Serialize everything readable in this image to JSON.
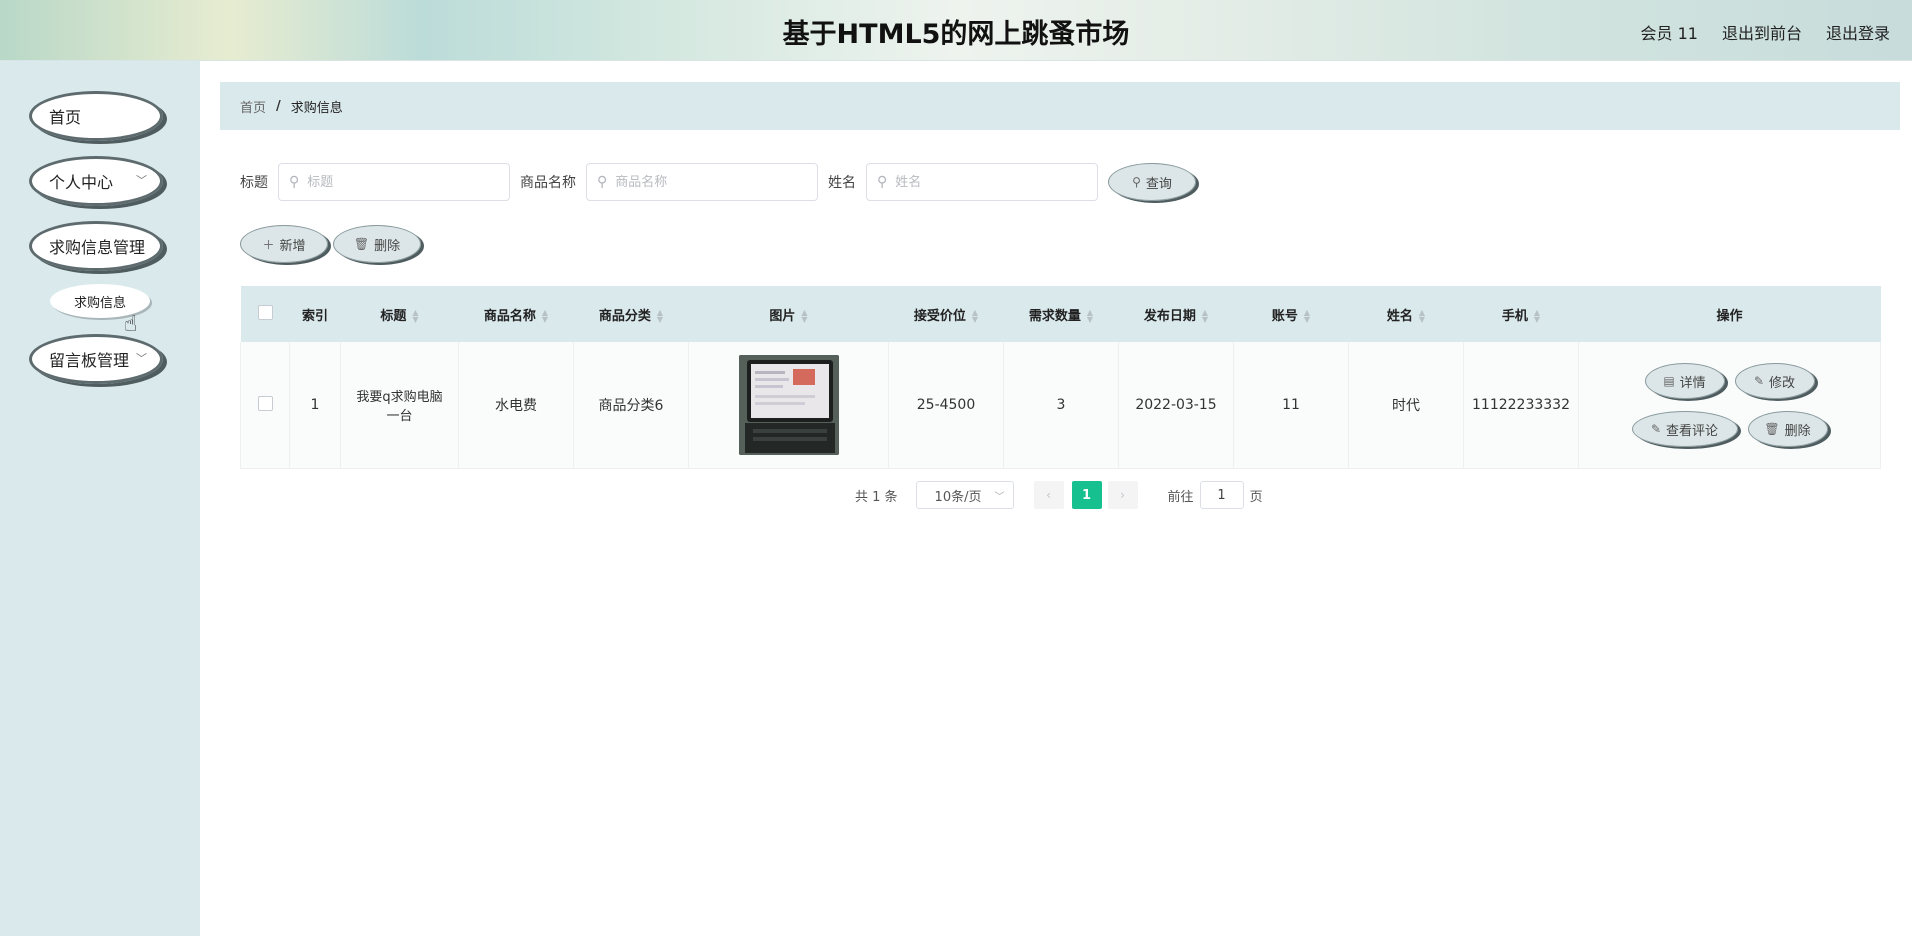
{
  "header": {
    "title": "基于HTML5的网上跳蚤市场",
    "nav": [
      "会员 11",
      "退出到前台",
      "退出登录"
    ]
  },
  "sidebar": {
    "items": [
      {
        "label": "首页",
        "has_dropdown": false
      },
      {
        "label": "个人中心",
        "has_dropdown": true
      },
      {
        "label": "求购信息管理",
        "has_dropdown": false
      },
      {
        "label": "留言板管理",
        "has_dropdown": true
      }
    ],
    "sub_item": "求购信息"
  },
  "breadcrumb": {
    "home": "首页",
    "separator": "/",
    "current": "求购信息"
  },
  "search": {
    "title_label": "标题",
    "title_placeholder": "标题",
    "product_label": "商品名称",
    "product_placeholder": "商品名称",
    "name_label": "姓名",
    "name_placeholder": "姓名",
    "query_button": "查询"
  },
  "actions": {
    "add_button": "新增",
    "delete_button": "删除"
  },
  "table": {
    "columns": [
      "索引",
      "标题",
      "商品名称",
      "商品分类",
      "图片",
      "接受价位",
      "需求数量",
      "发布日期",
      "账号",
      "姓名",
      "手机",
      "操作"
    ],
    "rows": [
      {
        "index": "1",
        "title": "我要q求购电脑一台",
        "product": "水电费",
        "category": "商品分类6",
        "image": "tablet-photo",
        "price": "25-4500",
        "quantity": "3",
        "date": "2022-03-15",
        "account": "11",
        "name": "时代",
        "phone": "11122233332",
        "ops": {
          "detail": "详情",
          "edit": "修改",
          "comments": "查看评论",
          "delete": "删除"
        }
      }
    ]
  },
  "pagination": {
    "total_text": "共 1 条",
    "page_size": "10条/页",
    "current_page": "1",
    "goto_label": "前往",
    "goto_value": "1",
    "page_suffix": "页"
  },
  "colors": {
    "accent": "#17c08f",
    "panel": "#dae9ec",
    "pill_shadow": "#4f5d60"
  }
}
